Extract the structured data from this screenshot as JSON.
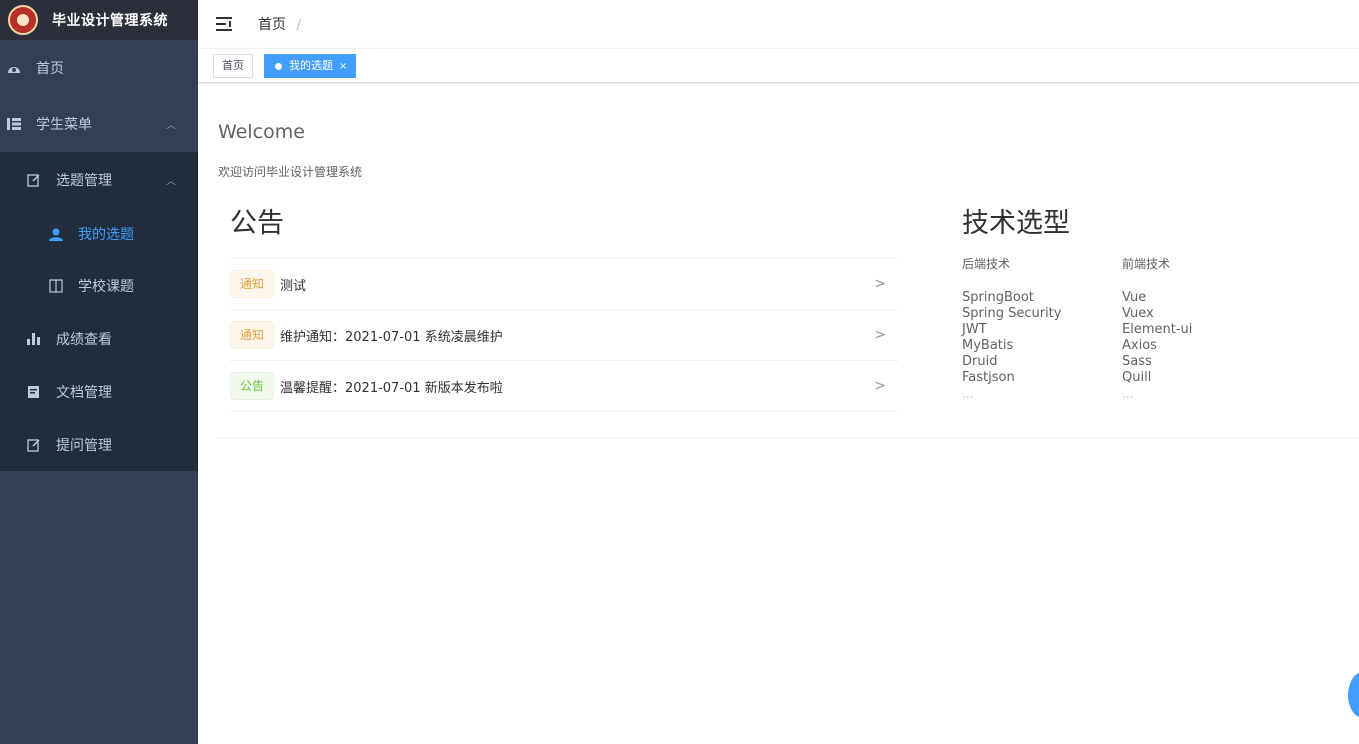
{
  "app": {
    "title": "毕业设计管理系统"
  },
  "sidebar": {
    "items": [
      {
        "label": "首页",
        "icon": "dashboard-icon"
      },
      {
        "label": "学生菜单",
        "icon": "tree-table-icon",
        "expanded": true
      },
      {
        "label": "选题管理",
        "icon": "edit-icon",
        "expanded": true
      },
      {
        "label": "我的选题",
        "icon": "user-icon",
        "active": true
      },
      {
        "label": "学校课题",
        "icon": "book-icon"
      },
      {
        "label": "成绩查看",
        "icon": "bar-chart-icon"
      },
      {
        "label": "文档管理",
        "icon": "document-icon"
      },
      {
        "label": "提问管理",
        "icon": "edit-icon"
      }
    ]
  },
  "header": {
    "breadcrumb": "首页",
    "separator": "/"
  },
  "tags": [
    {
      "label": "首页",
      "active": false
    },
    {
      "label": "我的选题",
      "active": true,
      "close": "×"
    }
  ],
  "main": {
    "welcome": "Welcome",
    "welcome_sub": "欢迎访问毕业设计管理系统",
    "notice": {
      "title": "公告",
      "items": [
        {
          "type": "通知",
          "text": "测试"
        },
        {
          "type": "通知",
          "text": "维护通知：2021-07-01 系统凌晨维护"
        },
        {
          "type": "公告",
          "text": "温馨提醒：2021-07-01 新版本发布啦"
        }
      ],
      "arrow": ">"
    },
    "tech": {
      "title": "技术选型",
      "backend": {
        "header": "后端技术",
        "items": [
          "SpringBoot",
          "Spring Security",
          "JWT",
          "MyBatis",
          "Druid",
          "Fastjson"
        ],
        "more": "..."
      },
      "frontend": {
        "header": "前端技术",
        "items": [
          "Vue",
          "Vuex",
          "Element-ui",
          "Axios",
          "Sass",
          "Quill"
        ],
        "more": "..."
      }
    }
  },
  "colors": {
    "sidebar_bg": "#304156",
    "submenu_bg": "#1f2d3d",
    "active": "#409eff",
    "warning": "#e6a23c",
    "success": "#67c23a"
  }
}
